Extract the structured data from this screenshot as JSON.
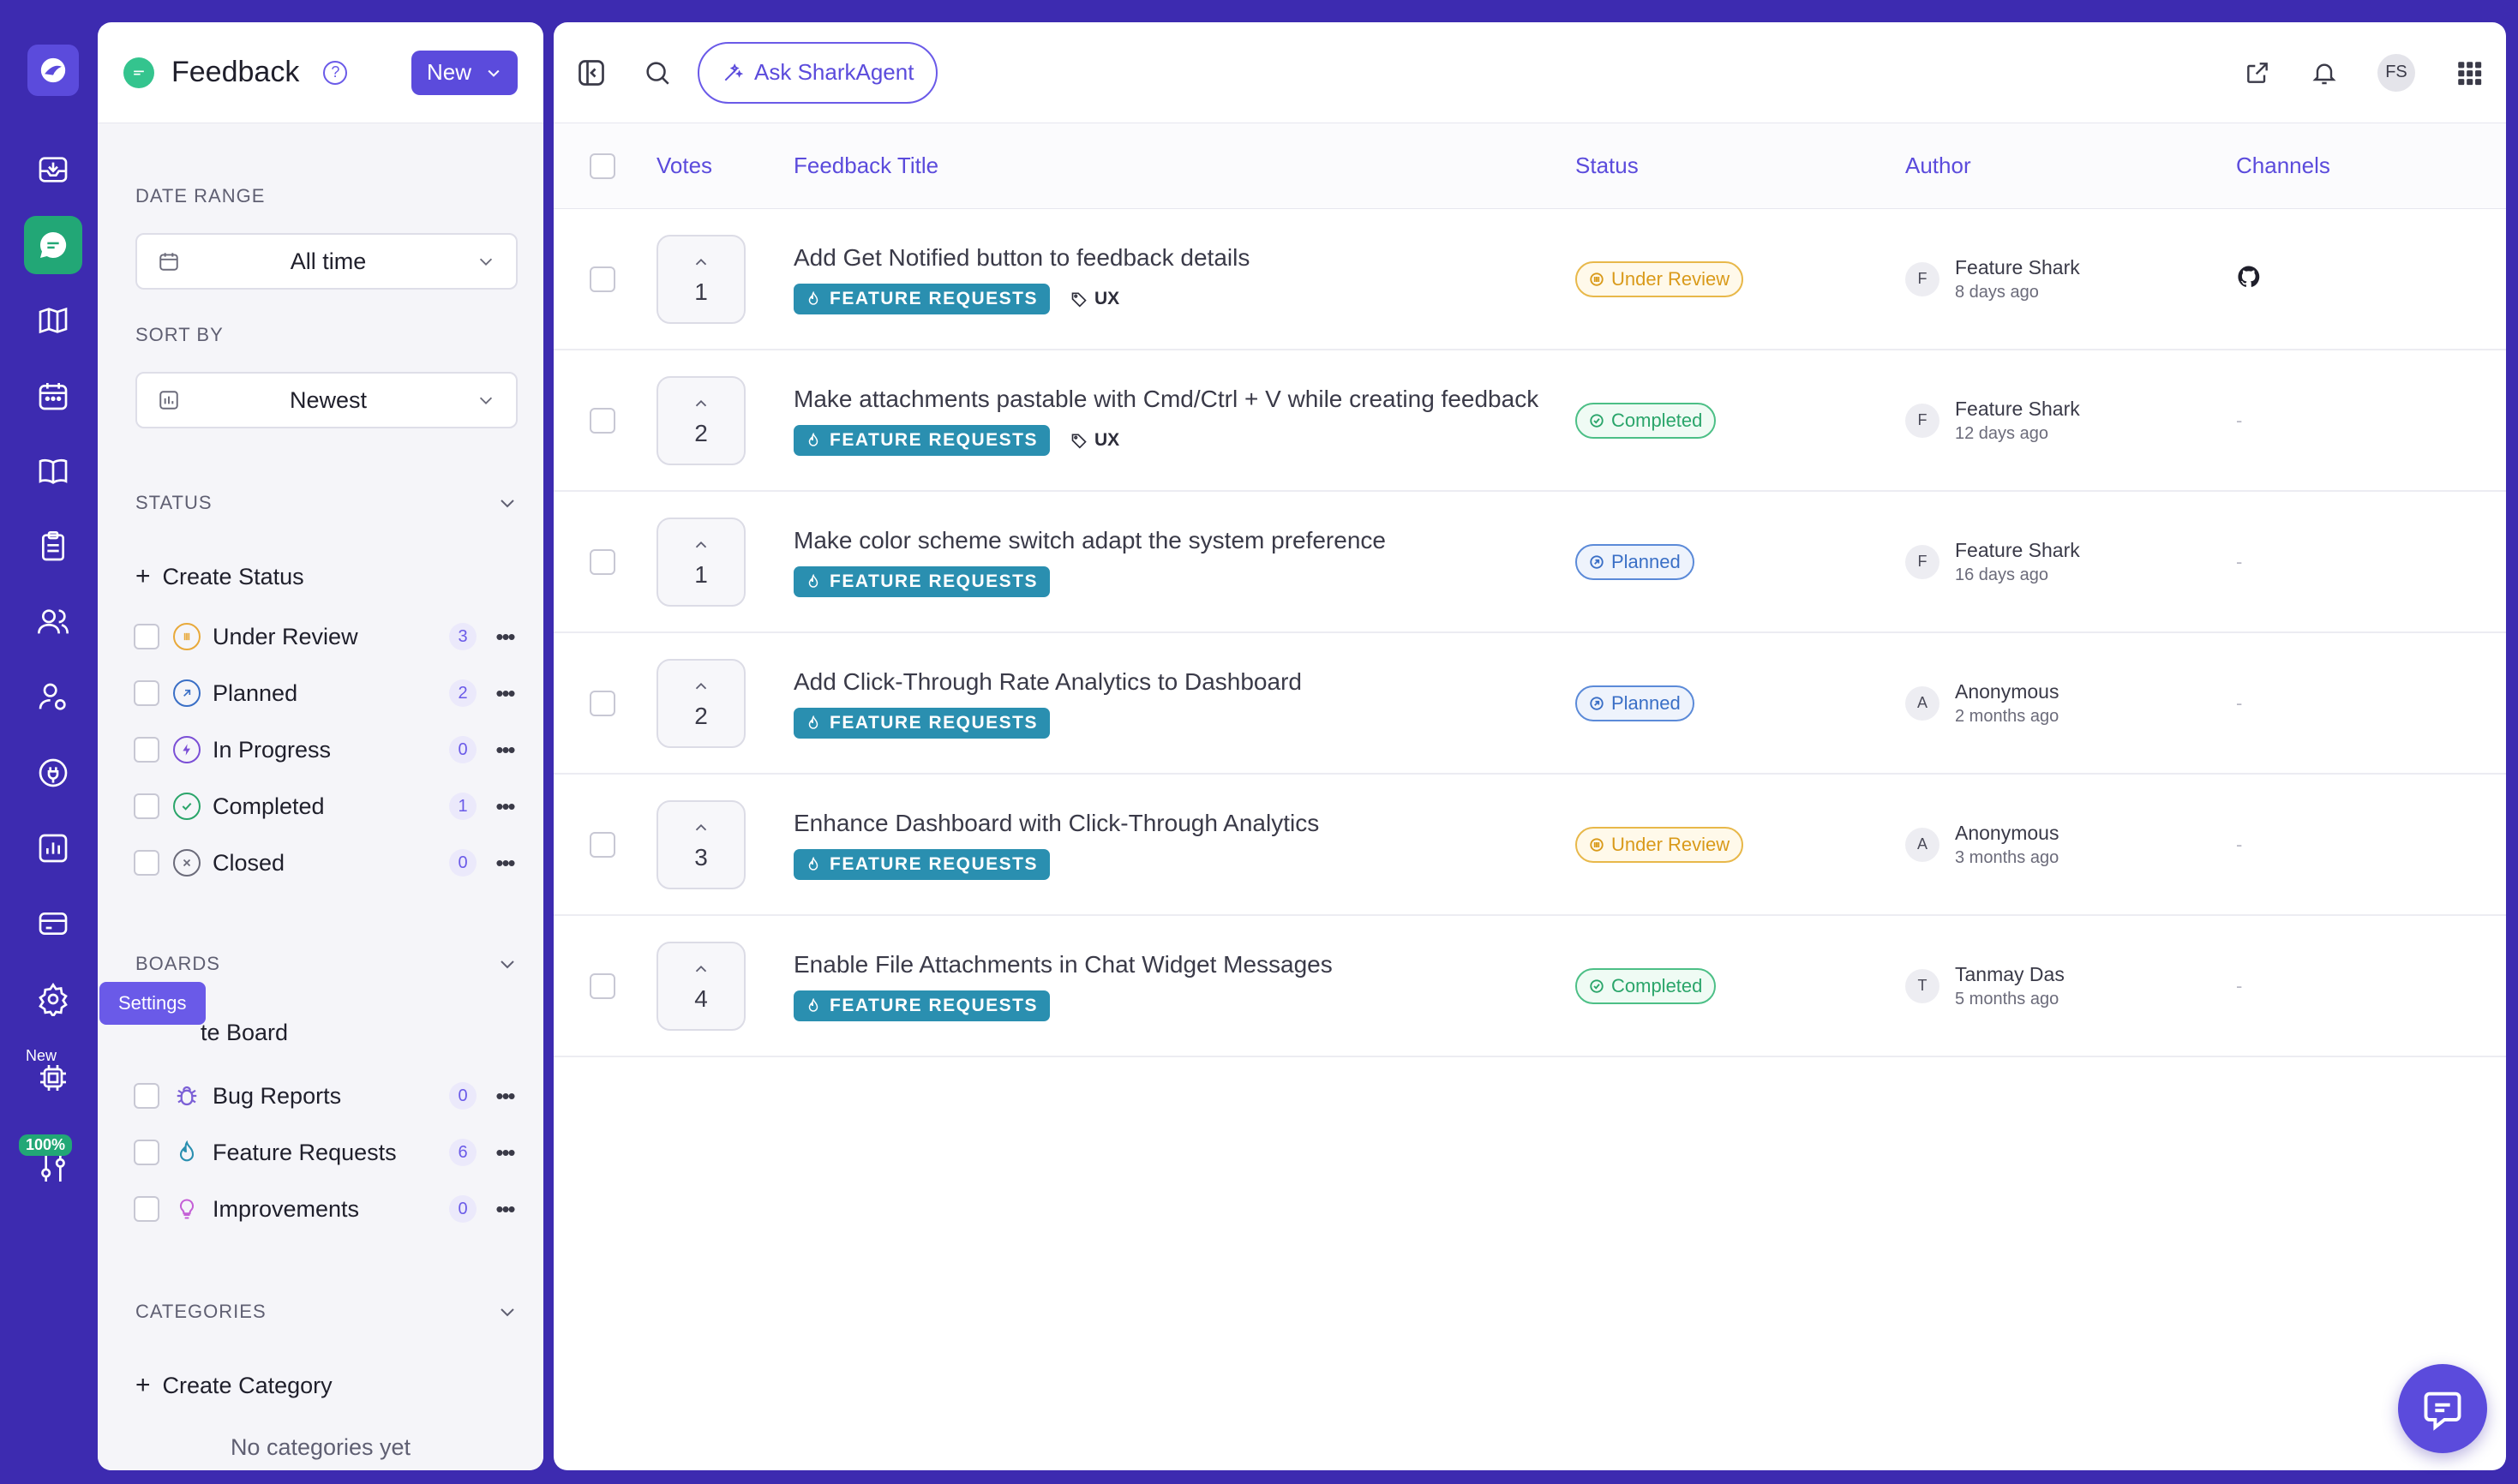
{
  "rail": {
    "items": [
      {
        "icon": "inbox-icon"
      },
      {
        "icon": "feedback-chat-icon",
        "active": true
      },
      {
        "icon": "roadmap-map-icon"
      },
      {
        "icon": "calendar-icon"
      },
      {
        "icon": "knowledge-book-icon"
      },
      {
        "icon": "clipboard-icon"
      },
      {
        "icon": "users-icon"
      },
      {
        "icon": "user-settings-icon"
      },
      {
        "icon": "integrations-plug-icon"
      },
      {
        "icon": "analytics-icon"
      },
      {
        "icon": "billing-card-icon"
      },
      {
        "icon": "gear-icon"
      },
      {
        "icon": "ai-chip-icon"
      },
      {
        "icon": "sliders-icon"
      }
    ],
    "tooltip": "Settings",
    "new_badge": "New",
    "percent_badge": "100%"
  },
  "panel": {
    "title": "Feedback",
    "new_button": "New",
    "date_range_label": "DATE RANGE",
    "date_range_value": "All time",
    "sort_by_label": "SORT BY",
    "sort_by_value": "Newest",
    "status_label": "STATUS",
    "create_status": "Create Status",
    "statuses": [
      {
        "label": "Under Review",
        "count": "3",
        "color": "#e8a93a"
      },
      {
        "label": "Planned",
        "count": "2",
        "color": "#3a6fc6"
      },
      {
        "label": "In Progress",
        "count": "0",
        "color": "#7b4fd6"
      },
      {
        "label": "Completed",
        "count": "1",
        "color": "#2aa56a"
      },
      {
        "label": "Closed",
        "count": "0",
        "color": "#6b6b7a"
      }
    ],
    "boards_label": "BOARDS",
    "create_board": "te Board",
    "boards": [
      {
        "label": "Bug Reports",
        "count": "0",
        "color": "#7b5fd6"
      },
      {
        "label": "Feature Requests",
        "count": "6",
        "color": "#2a8fb0"
      },
      {
        "label": "Improvements",
        "count": "0",
        "color": "#c45fd6"
      }
    ],
    "categories_label": "CATEGORIES",
    "create_category": "Create Category",
    "no_categories": "No categories yet"
  },
  "topbar": {
    "ask_button": "Ask SharkAgent",
    "avatar_initials": "FS"
  },
  "table": {
    "headers": {
      "votes": "Votes",
      "title": "Feedback Title",
      "status": "Status",
      "author": "Author",
      "channels": "Channels"
    },
    "rows": [
      {
        "votes": "1",
        "title": "Add Get Notified button to feedback details",
        "board": "FEATURE REQUESTS",
        "tag": "UX",
        "status": "Under Review",
        "status_kind": "review",
        "author_initial": "F",
        "author": "Feature Shark",
        "time": "8 days ago",
        "channel": "github-icon"
      },
      {
        "votes": "2",
        "title": "Make attachments pastable with Cmd/Ctrl + V while creating feedback",
        "board": "FEATURE REQUESTS",
        "tag": "UX",
        "status": "Completed",
        "status_kind": "completed",
        "author_initial": "F",
        "author": "Feature Shark",
        "time": "12 days ago",
        "channel": "-"
      },
      {
        "votes": "1",
        "title": "Make color scheme switch adapt the system preference",
        "board": "FEATURE REQUESTS",
        "tag": "",
        "status": "Planned",
        "status_kind": "planned",
        "author_initial": "F",
        "author": "Feature Shark",
        "time": "16 days ago",
        "channel": "-"
      },
      {
        "votes": "2",
        "title": "Add Click-Through Rate Analytics to Dashboard",
        "board": "FEATURE REQUESTS",
        "tag": "",
        "status": "Planned",
        "status_kind": "planned",
        "author_initial": "A",
        "author": "Anonymous",
        "time": "2 months ago",
        "channel": "-"
      },
      {
        "votes": "3",
        "title": "Enhance Dashboard with Click-Through Analytics",
        "board": "FEATURE REQUESTS",
        "tag": "",
        "status": "Under Review",
        "status_kind": "review",
        "author_initial": "A",
        "author": "Anonymous",
        "time": "3 months ago",
        "channel": "-"
      },
      {
        "votes": "4",
        "title": "Enable File Attachments in Chat Widget Messages",
        "board": "FEATURE REQUESTS",
        "tag": "",
        "status": "Completed",
        "status_kind": "completed",
        "author_initial": "T",
        "author": "Tanmay Das",
        "time": "5 months ago",
        "channel": "-"
      }
    ]
  },
  "colors": {
    "brand": "#3d2bb0",
    "accent": "#5b4bdc",
    "feedback_green": "#22a776",
    "board_tag": "#2a8fb0"
  }
}
